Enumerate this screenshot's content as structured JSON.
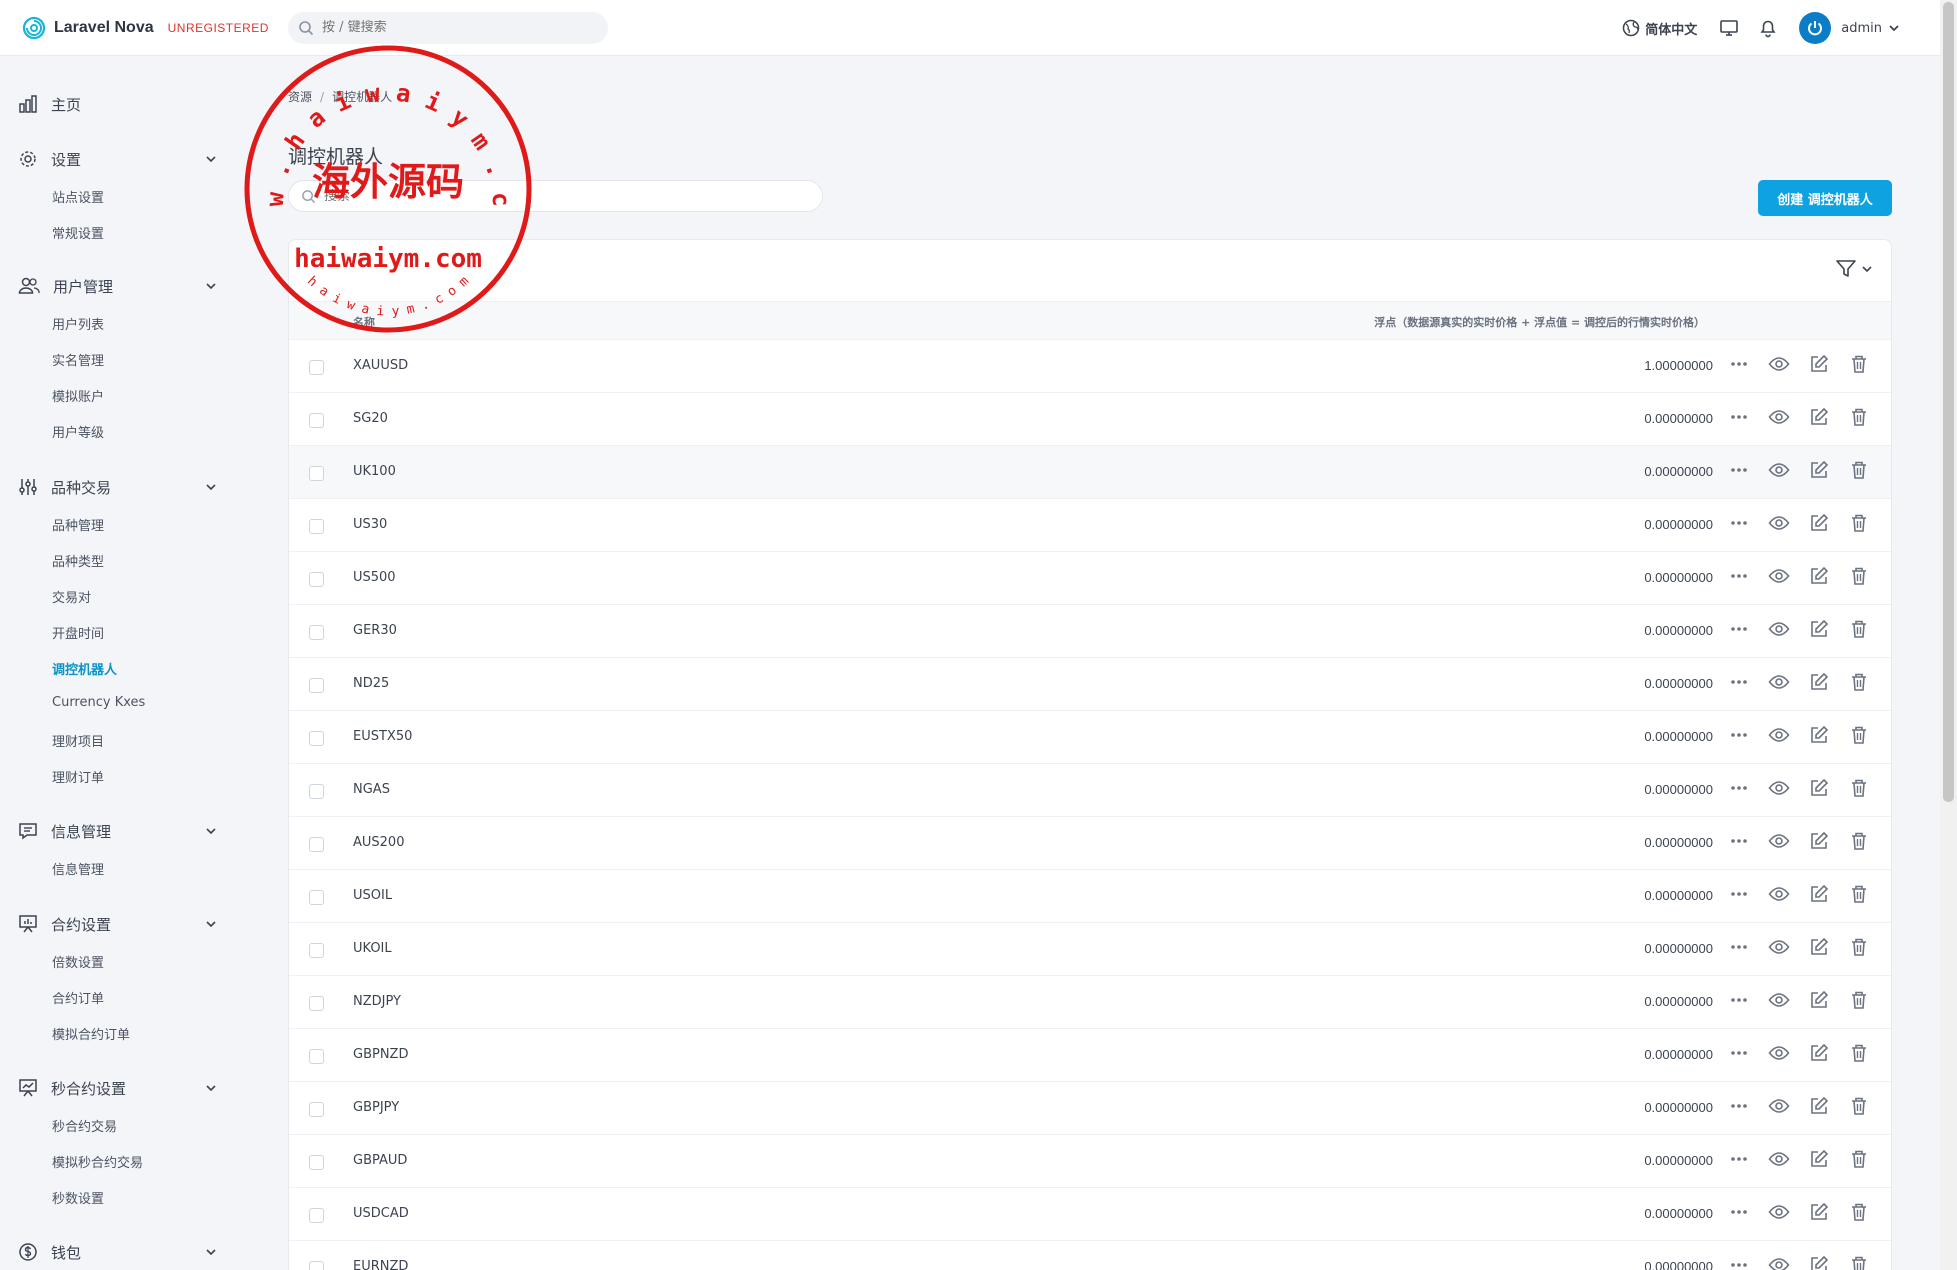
{
  "header": {
    "brand": "Laravel Nova",
    "unregistered": "UNREGISTERED",
    "search_placeholder": "按 / 键搜索",
    "language": "简体中文",
    "user": "admin"
  },
  "sidebar": {
    "home": "主页",
    "sections": [
      {
        "label": "设置",
        "items": [
          "站点设置",
          "常规设置"
        ]
      },
      {
        "label": "用户管理",
        "items": [
          "用户列表",
          "实名管理",
          "模拟账户",
          "用户等级"
        ]
      },
      {
        "label": "品种交易",
        "items": [
          "品种管理",
          "品种类型",
          "交易对",
          "开盘时间",
          "调控机器人",
          "Currency Kxes",
          "理财项目",
          "理财订单"
        ]
      },
      {
        "label": "信息管理",
        "items": [
          "信息管理"
        ]
      },
      {
        "label": "合约设置",
        "items": [
          "倍数设置",
          "合约订单",
          "模拟合约订单"
        ]
      },
      {
        "label": "秒合约设置",
        "items": [
          "秒合约交易",
          "模拟秒合约交易",
          "秒数设置"
        ]
      },
      {
        "label": "钱包",
        "items": []
      }
    ]
  },
  "breadcrumb": {
    "root": "资源",
    "current": "调控机器人"
  },
  "page": {
    "title": "调控机器人",
    "search_placeholder": "搜索",
    "create_button": "创建 调控机器人"
  },
  "table": {
    "columns": {
      "name": "名称",
      "float": "浮点（数据源真实的实时价格 + 浮点值 = 调控后的行情实时价格）"
    },
    "rows": [
      {
        "name": "XAUUSD",
        "float": "1.00000000"
      },
      {
        "name": "SG20",
        "float": "0.00000000"
      },
      {
        "name": "UK100",
        "float": "0.00000000"
      },
      {
        "name": "US30",
        "float": "0.00000000"
      },
      {
        "name": "US500",
        "float": "0.00000000"
      },
      {
        "name": "GER30",
        "float": "0.00000000"
      },
      {
        "name": "ND25",
        "float": "0.00000000"
      },
      {
        "name": "EUSTX50",
        "float": "0.00000000"
      },
      {
        "name": "NGAS",
        "float": "0.00000000"
      },
      {
        "name": "AUS200",
        "float": "0.00000000"
      },
      {
        "name": "USOIL",
        "float": "0.00000000"
      },
      {
        "name": "UKOIL",
        "float": "0.00000000"
      },
      {
        "name": "NZDJPY",
        "float": "0.00000000"
      },
      {
        "name": "GBPNZD",
        "float": "0.00000000"
      },
      {
        "name": "GBPJPY",
        "float": "0.00000000"
      },
      {
        "name": "GBPAUD",
        "float": "0.00000000"
      },
      {
        "name": "USDCAD",
        "float": "0.00000000"
      },
      {
        "name": "EURNZD",
        "float": "0.00000000"
      }
    ]
  },
  "watermark": {
    "ring_top": "w w w . h a i w a i y m . c o m",
    "center_cn": "海外源码",
    "center_url": "haiwaiym.com",
    "ring_bottom": "h a i w a i y m . c o m"
  },
  "colors": {
    "accent": "#0ea2e2",
    "active_nav": "#0e93c6",
    "unregistered": "#e0332b",
    "stamp": "#e01919"
  }
}
